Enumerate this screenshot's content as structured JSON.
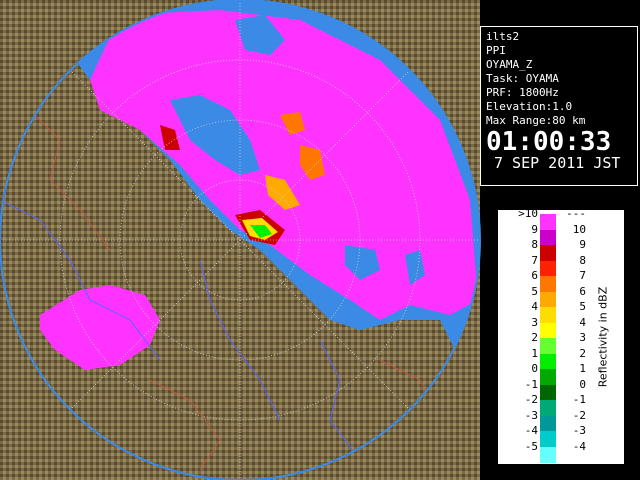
{
  "info": {
    "site": "ilts2",
    "product": "PPI",
    "variable": "OYAMA_Z",
    "task": "Task: OYAMA",
    "prf": "PRF: 1800Hz",
    "elevation": "Elevation:1.0",
    "range": "Max Range:80 km",
    "time": "01:00:33",
    "date": "7 SEP 2011 JST"
  },
  "legend": {
    "title": "Reflectivity in dBZ",
    "rows": [
      {
        "left": ">10",
        "right": "---",
        "color": "#ff33ff"
      },
      {
        "left": "9",
        "right": "10",
        "color": "#cc00cc"
      },
      {
        "left": "8",
        "right": "9",
        "color": "#cc0000"
      },
      {
        "left": "7",
        "right": "8",
        "color": "#ff2200"
      },
      {
        "left": "6",
        "right": "7",
        "color": "#ff7700"
      },
      {
        "left": "5",
        "right": "6",
        "color": "#ffaa00"
      },
      {
        "left": "4",
        "right": "5",
        "color": "#ffdd00"
      },
      {
        "left": "3",
        "right": "4",
        "color": "#ffff00"
      },
      {
        "left": "2",
        "right": "3",
        "color": "#66ff33"
      },
      {
        "left": "1",
        "right": "2",
        "color": "#00ee00"
      },
      {
        "left": "0",
        "right": "1",
        "color": "#00aa00"
      },
      {
        "left": "-1",
        "right": "0",
        "color": "#006600"
      },
      {
        "left": "-2",
        "right": "-1",
        "color": "#00aa77"
      },
      {
        "left": "-3",
        "right": "-2",
        "color": "#009999"
      },
      {
        "left": "-4",
        "right": "-3",
        "color": "#00cccc"
      },
      {
        "left": "-5",
        "right": "-4",
        "color": "#66ffff"
      }
    ]
  },
  "colors": {
    "sea": "#3a8ae6",
    "land": "#7a6a45",
    "echo": "#ff33ff"
  }
}
